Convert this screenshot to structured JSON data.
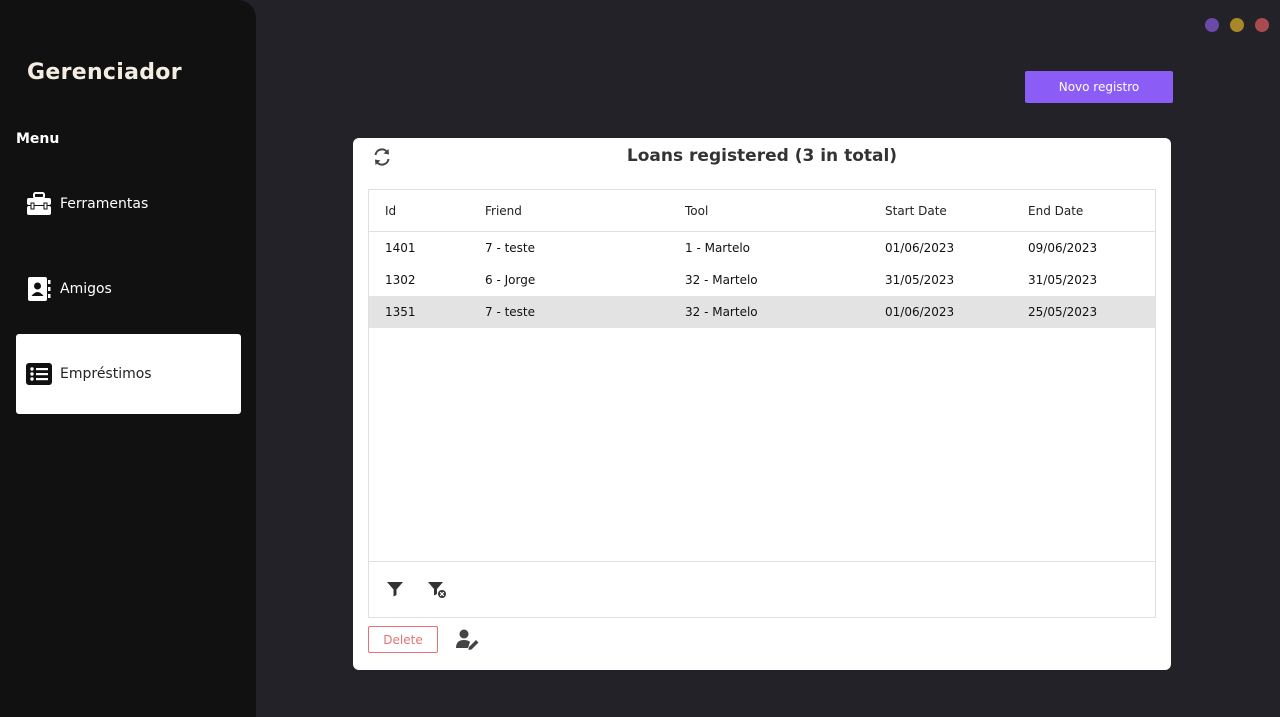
{
  "window_controls": {
    "colors": [
      "#6a4aa8",
      "#a88728",
      "#a84a4e"
    ]
  },
  "sidebar": {
    "title": "Gerenciador",
    "menu_label": "Menu",
    "items": [
      {
        "label": "Ferramentas",
        "icon": "toolbox-icon"
      },
      {
        "label": "Amigos",
        "icon": "contact-book-icon"
      },
      {
        "label": "Empréstimos",
        "icon": "list-icon",
        "active": true
      }
    ]
  },
  "header": {
    "new_button_label": "Novo registro",
    "accent_color": "#8b5cf6"
  },
  "card": {
    "title": "Loans registered (3 in total)",
    "columns": [
      "Id",
      "Friend",
      "Tool",
      "Start Date",
      "End Date"
    ],
    "rows": [
      [
        "1401",
        "7 - teste",
        "1 - Martelo",
        "01/06/2023",
        "09/06/2023"
      ],
      [
        "1302",
        "6 - Jorge",
        "32 - Martelo",
        "31/05/2023",
        "31/05/2023"
      ],
      [
        "1351",
        "7 - teste",
        "32 - Martelo",
        "01/06/2023",
        "25/05/2023"
      ]
    ],
    "selected_row_index": 2,
    "delete_label": "Delete"
  }
}
